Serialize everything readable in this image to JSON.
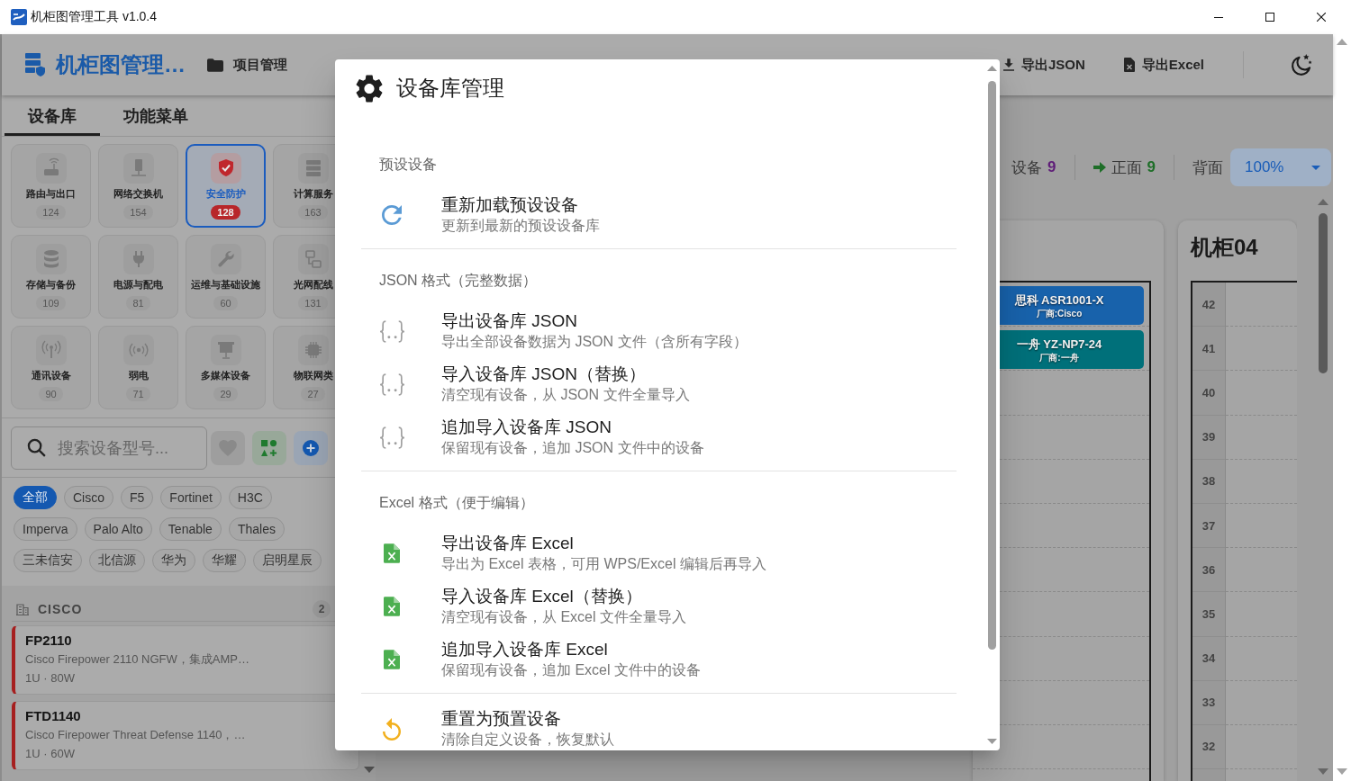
{
  "window": {
    "title": "机柜图管理工具 v1.0.4"
  },
  "header": {
    "title": "机柜图管理…",
    "nav": [
      {
        "label": "项目管理",
        "kind": "folder"
      }
    ],
    "actions": [
      {
        "label": "导出JSON",
        "kind": "download"
      },
      {
        "label": "导出Excel",
        "kind": "excel"
      }
    ]
  },
  "sidebar": {
    "tabs": [
      {
        "label": "设备库",
        "selected": true
      },
      {
        "label": "功能菜单",
        "selected": false
      }
    ],
    "categories": [
      {
        "name": "路由与出口",
        "count": "124",
        "kind": "router",
        "selected": false
      },
      {
        "name": "网络交换机",
        "count": "154",
        "kind": "switch",
        "selected": false
      },
      {
        "name": "安全防护",
        "count": "128",
        "kind": "security",
        "selected": true
      },
      {
        "name": "计算服务",
        "count": "163",
        "kind": "server",
        "selected": false
      },
      {
        "name": "存储与备份",
        "count": "109",
        "kind": "storage",
        "selected": false
      },
      {
        "name": "电源与配电",
        "count": "81",
        "kind": "power",
        "selected": false
      },
      {
        "name": "运维与基础设施",
        "count": "60",
        "kind": "tools",
        "selected": false
      },
      {
        "name": "光网配线",
        "count": "131",
        "kind": "patch",
        "selected": false
      },
      {
        "name": "通讯设备",
        "count": "90",
        "kind": "antenna",
        "selected": false
      },
      {
        "name": "弱电",
        "count": "71",
        "kind": "signal",
        "selected": false
      },
      {
        "name": "多媒体设备",
        "count": "29",
        "kind": "media",
        "selected": false
      },
      {
        "name": "物联网类",
        "count": "27",
        "kind": "iot",
        "selected": false
      }
    ],
    "search": {
      "placeholder": "搜索设备型号..."
    },
    "filters": [
      {
        "label": "全部",
        "selected": true
      },
      {
        "label": "Cisco",
        "selected": false
      },
      {
        "label": "F5",
        "selected": false
      },
      {
        "label": "Fortinet",
        "selected": false
      },
      {
        "label": "H3C",
        "selected": false
      },
      {
        "label": "Imperva",
        "selected": false
      },
      {
        "label": "Palo Alto",
        "selected": false
      },
      {
        "label": "Tenable",
        "selected": false
      },
      {
        "label": "Thales",
        "selected": false
      },
      {
        "label": "三未信安",
        "selected": false
      },
      {
        "label": "北信源",
        "selected": false
      },
      {
        "label": "华为",
        "selected": false
      },
      {
        "label": "华耀",
        "selected": false
      },
      {
        "label": "启明星辰",
        "selected": false
      }
    ],
    "vendor_group": {
      "name": "CISCO",
      "count": "2",
      "devices": [
        {
          "model": "FP2110",
          "description": "Cisco Firepower 2110 NGFW，集成AMP…",
          "spec": "1U · 80W"
        },
        {
          "model": "FTD1140",
          "description": "Cisco Firepower Threat Defense 1140，…",
          "spec": "1U · 60W"
        }
      ]
    }
  },
  "rack_view": {
    "stats": [
      {
        "label": "设备",
        "count": "9",
        "color": "#5f1e78",
        "kind": "total"
      },
      {
        "label": "正面",
        "count": "9",
        "color": "#1e6e28",
        "kind": "front"
      },
      {
        "label": "背面",
        "kind": "back"
      }
    ],
    "zoom": {
      "value": "100%"
    },
    "cabinets": [
      {
        "devices": [
          {
            "name": "思科 ASR1001-X",
            "vendor": "厂商:Cisco",
            "color": "#1862ab"
          },
          {
            "name": "一舟 YZ-NP7-24",
            "vendor": "厂商:一舟",
            "color": "#00707a"
          }
        ]
      },
      {
        "title": "机柜04",
        "units": [
          "42",
          "41",
          "40",
          "39",
          "38",
          "37",
          "36",
          "35",
          "34",
          "33",
          "32"
        ]
      }
    ]
  },
  "dialog": {
    "title": "设备库管理",
    "sections": [
      {
        "label": "预设设备",
        "items": [
          {
            "kind": "reload",
            "title": "重新加载预设设备",
            "subtitle": "更新到最新的预设设备库"
          }
        ]
      },
      {
        "label": "JSON 格式（完整数据）",
        "items": [
          {
            "kind": "json",
            "title": "导出设备库 JSON",
            "subtitle": "导出全部设备数据为 JSON 文件（含所有字段）"
          },
          {
            "kind": "json",
            "title": "导入设备库 JSON（替换）",
            "subtitle": "清空现有设备，从 JSON 文件全量导入"
          },
          {
            "kind": "json",
            "title": "追加导入设备库 JSON",
            "subtitle": "保留现有设备，追加 JSON 文件中的设备"
          }
        ]
      },
      {
        "label": "Excel 格式（便于编辑）",
        "items": [
          {
            "kind": "excel",
            "title": "导出设备库 Excel",
            "subtitle": "导出为 Excel 表格，可用 WPS/Excel 编辑后再导入"
          },
          {
            "kind": "excel",
            "title": "导入设备库 Excel（替换）",
            "subtitle": "清空现有设备，从 Excel 文件全量导入"
          },
          {
            "kind": "excel",
            "title": "追加导入设备库 Excel",
            "subtitle": "保留现有设备，追加 Excel 文件中的设备"
          }
        ]
      },
      {
        "items": [
          {
            "kind": "reset",
            "title": "重置为预置设备",
            "subtitle": "清除自定义设备，恢复默认"
          }
        ]
      }
    ]
  }
}
